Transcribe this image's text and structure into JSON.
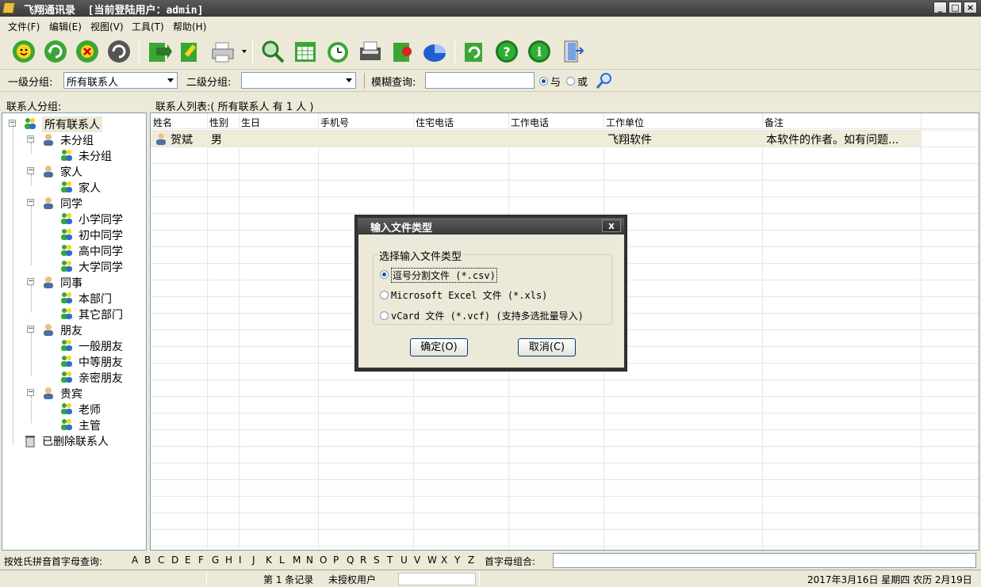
{
  "window": {
    "title": "飞翔通讯录  [当前登陆用户：admin]"
  },
  "menu": [
    "文件(F)",
    "编辑(E)",
    "视图(V)",
    "工具(T)",
    "帮助(H)"
  ],
  "filter": {
    "group1_label": "一级分组:",
    "group1_value": "所有联系人",
    "group2_label": "二级分组:",
    "group2_value": "",
    "fuzzy_label": "模糊查询:",
    "fuzzy_value": "",
    "and_label": "与",
    "or_label": "或",
    "mode": "与"
  },
  "tree": {
    "header": "联系人分组:",
    "root": "所有联系人",
    "groups": [
      {
        "label": "未分组",
        "children": [
          "未分组"
        ]
      },
      {
        "label": "家人",
        "children": [
          "家人"
        ]
      },
      {
        "label": "同学",
        "children": [
          "小学同学",
          "初中同学",
          "高中同学",
          "大学同学"
        ]
      },
      {
        "label": "同事",
        "children": [
          "本部门",
          "其它部门"
        ]
      },
      {
        "label": "朋友",
        "children": [
          "一般朋友",
          "中等朋友",
          "亲密朋友"
        ]
      },
      {
        "label": "贵宾",
        "children": [
          "老师",
          "主管"
        ]
      }
    ],
    "deleted": "已删除联系人"
  },
  "contacts": {
    "header": "联系人列表:( 所有联系人 有 1 人 )",
    "columns": [
      "姓名",
      "性别",
      "生日",
      "手机号",
      "住宅电话",
      "工作电话",
      "工作单位",
      "备注"
    ],
    "rows": [
      {
        "name": "贺斌",
        "gender": "男",
        "birthday": "",
        "mobile": "",
        "home_phone": "",
        "work_phone": "",
        "company": "飞翔软件",
        "note": "本软件的作者。如有问题..."
      }
    ]
  },
  "alpha": {
    "label": "按姓氏拼音首字母查询:",
    "letters": [
      "A",
      "B",
      "C",
      "D",
      "E",
      "F",
      "G",
      "H",
      "I",
      "J",
      "K",
      "L",
      "M",
      "N",
      "O",
      "P",
      "Q",
      "R",
      "S",
      "T",
      "U",
      "V",
      "W",
      "X",
      "Y",
      "Z"
    ],
    "combo_label": "首字母组合:",
    "combo_value": ""
  },
  "status": {
    "record": "第 1 条记录",
    "license": "未授权用户",
    "date": "2017年3月16日 星期四 农历 2月19日"
  },
  "dialog": {
    "title": "输入文件类型",
    "group_title": "选择输入文件类型",
    "options": [
      "逗号分割文件 (*.csv)",
      "Microsoft Excel 文件 (*.xls)",
      "vCard 文件 (*.vcf) (支持多选批量导入)"
    ],
    "selected_index": 0,
    "ok": "确定(O)",
    "cancel": "取消(C)",
    "close": "x"
  },
  "colors": {
    "title_bar": "#4a4a4a",
    "selection": "#f0ecda",
    "accent": "#1c4fa0"
  },
  "icons": [
    "smiley-add-icon",
    "refresh-icon",
    "delete-icon",
    "edit-icon",
    "import-icon",
    "export-icon",
    "print-icon",
    "search-icon",
    "calendar-icon",
    "clock-icon",
    "fax-icon",
    "birthday-icon",
    "chart-icon",
    "update-icon",
    "help-icon",
    "info-icon",
    "exit-icon"
  ]
}
